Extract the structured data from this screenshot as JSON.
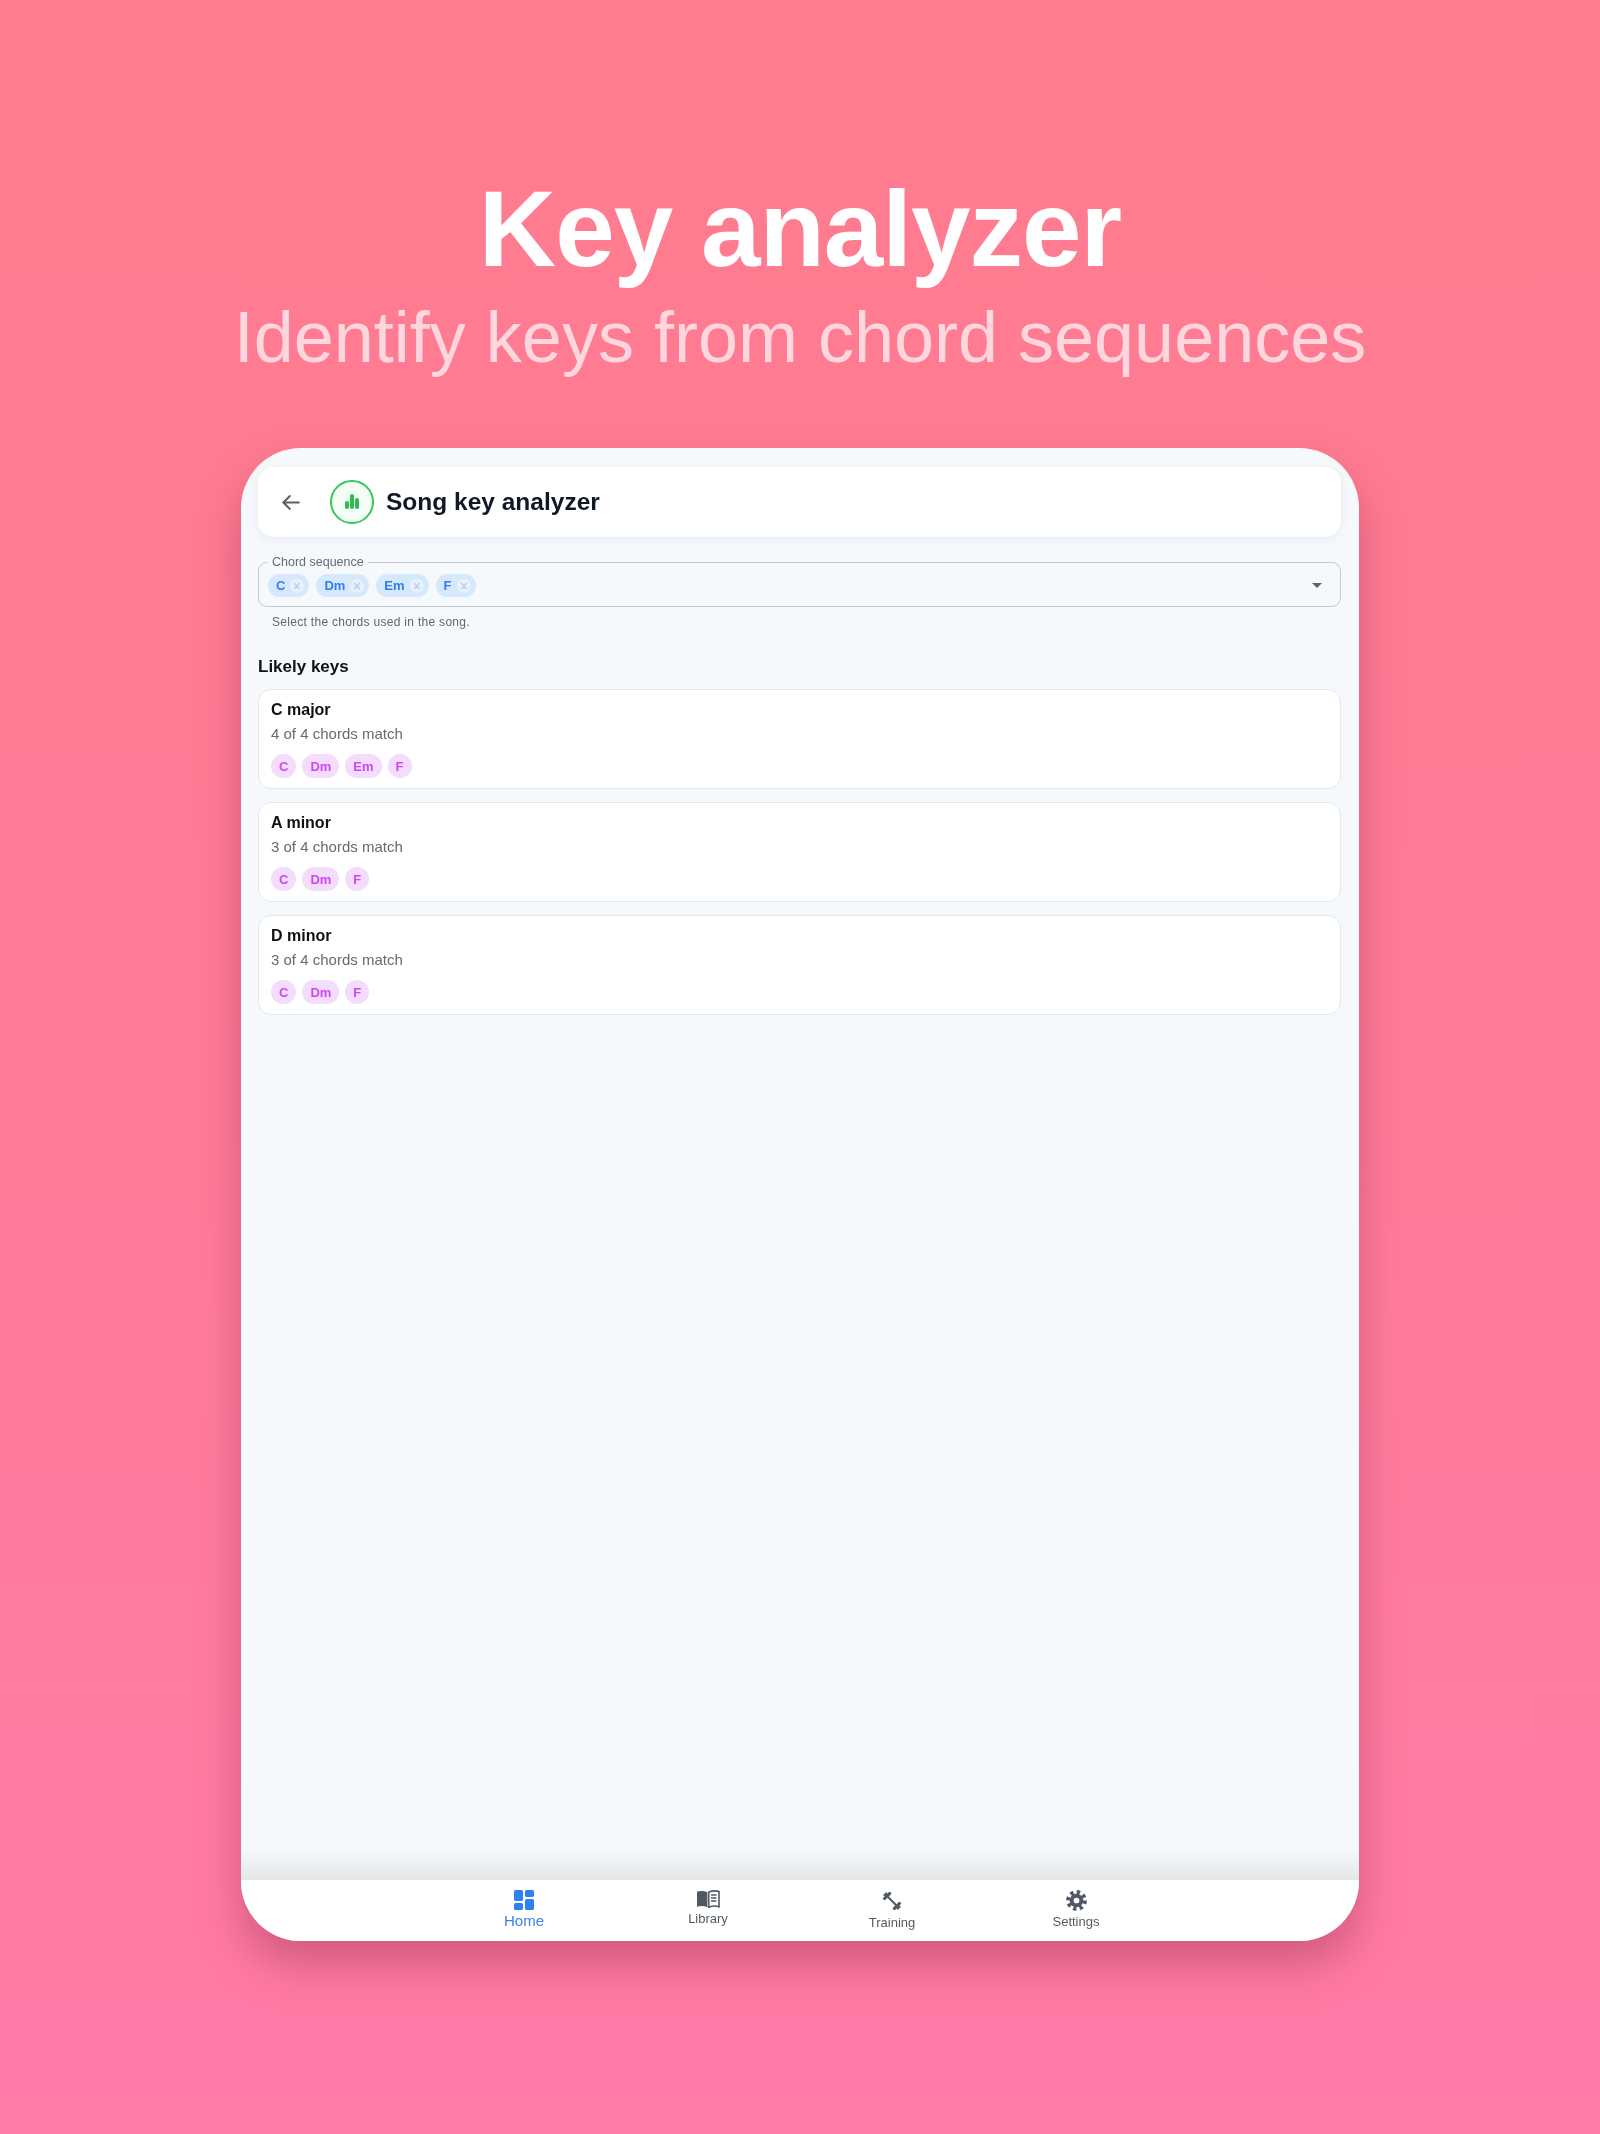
{
  "hero": {
    "title": "Key analyzer",
    "subtitle": "Identify keys from chord sequences"
  },
  "app_bar": {
    "title": "Song key analyzer"
  },
  "chord_field": {
    "label": "Chord sequence",
    "chips": [
      "C",
      "Dm",
      "Em",
      "F"
    ],
    "helper_text": "Select the chords used in the song."
  },
  "section_title": "Likely keys",
  "key_results": [
    {
      "name": "C major",
      "match": "4 of 4 chords match",
      "chords": [
        "C",
        "Dm",
        "Em",
        "F"
      ]
    },
    {
      "name": "A minor",
      "match": "3 of 4 chords match",
      "chords": [
        "C",
        "Dm",
        "F"
      ]
    },
    {
      "name": "D minor",
      "match": "3 of 4 chords match",
      "chords": [
        "C",
        "Dm",
        "F"
      ]
    }
  ],
  "bottom_nav": [
    {
      "label": "Home",
      "selected": true
    },
    {
      "label": "Library",
      "selected": false
    },
    {
      "label": "Training",
      "selected": false
    },
    {
      "label": "Settings",
      "selected": false
    }
  ]
}
